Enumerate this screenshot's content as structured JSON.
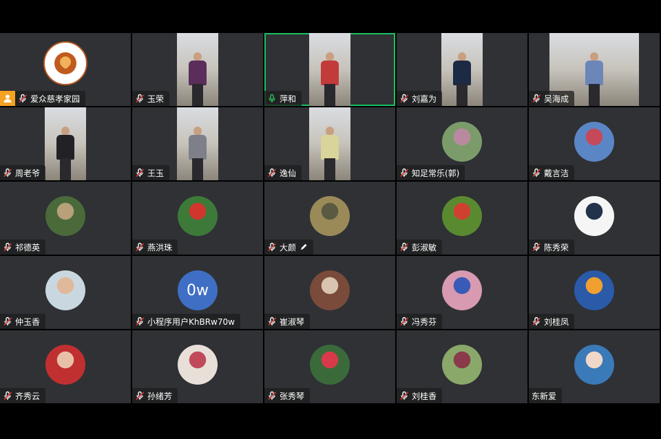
{
  "colors": {
    "tile_bg": "#2f3135",
    "active_border": "#19c15f",
    "muted_icon": "#d03a36",
    "unmuted_icon": "#2fc463",
    "host_badge": "#f5a122",
    "text_avatar": "#3f6fc4"
  },
  "participants": [
    {
      "name": "爱众慈孝家园",
      "kind": "logo",
      "host": true,
      "mic": "muted"
    },
    {
      "name": "玉荣",
      "kind": "video",
      "mic": "muted",
      "shirt": "#5a2d5a"
    },
    {
      "name": "萍和",
      "kind": "video",
      "mic": "on",
      "active": true,
      "shirt": "#c23a3a"
    },
    {
      "name": "刘嘉为",
      "kind": "video",
      "mic": "muted",
      "shirt": "#1c2a44"
    },
    {
      "name": "吴海成",
      "kind": "video-wide",
      "mic": "muted",
      "shirt": "#6b86b8"
    },
    {
      "name": "周老爷",
      "kind": "video",
      "mic": "muted",
      "shirt": "#222226"
    },
    {
      "name": "王玉",
      "kind": "video",
      "mic": "muted",
      "shirt": "#7d8088"
    },
    {
      "name": "逸仙",
      "kind": "video",
      "mic": "muted",
      "shirt": "#d8d49a"
    },
    {
      "name": "知足常乐(郭)",
      "kind": "photo",
      "mic": "muted",
      "tone": [
        "#7b9c6a",
        "#b98a9f"
      ]
    },
    {
      "name": "戴言洁",
      "kind": "photo",
      "mic": "muted",
      "tone": [
        "#5b86c6",
        "#c44a5a"
      ]
    },
    {
      "name": "祁德英",
      "kind": "photo",
      "mic": "muted",
      "tone": [
        "#4a6a3a",
        "#b7a07a"
      ]
    },
    {
      "name": "燕洪珠",
      "kind": "photo",
      "mic": "muted",
      "tone": [
        "#3d7a3a",
        "#d0352e"
      ]
    },
    {
      "name": "大颜",
      "kind": "photo",
      "mic": "muted",
      "pencil": true,
      "tone": [
        "#9a8a58",
        "#5a5a42"
      ]
    },
    {
      "name": "彭淑敏",
      "kind": "photo",
      "mic": "muted",
      "tone": [
        "#5a8a30",
        "#d04030"
      ]
    },
    {
      "name": "陈秀荣",
      "kind": "photo",
      "mic": "muted",
      "tone": [
        "#f5f5f5",
        "#22324a"
      ]
    },
    {
      "name": "仲玉香",
      "kind": "photo",
      "mic": "muted",
      "tone": [
        "#c9d8e0",
        "#e0b89a"
      ]
    },
    {
      "name": "小程序用户KhBRw70w",
      "kind": "text",
      "initials": "0w",
      "mic": "muted"
    },
    {
      "name": "崔淑琴",
      "kind": "photo",
      "mic": "muted",
      "tone": [
        "#7a4a3a",
        "#d8c4b0"
      ]
    },
    {
      "name": "冯秀芬",
      "kind": "photo",
      "mic": "muted",
      "tone": [
        "#d89ab0",
        "#3a5ab8"
      ]
    },
    {
      "name": "刘桂凤",
      "kind": "photo",
      "mic": "muted",
      "tone": [
        "#2a5aa8",
        "#f0a030"
      ]
    },
    {
      "name": "齐秀云",
      "kind": "photo",
      "mic": "muted",
      "tone": [
        "#c03030",
        "#e8c0a8"
      ]
    },
    {
      "name": "孙绪芳",
      "kind": "photo",
      "mic": "muted",
      "tone": [
        "#e8e0d8",
        "#c04a5a"
      ]
    },
    {
      "name": "张秀琴",
      "kind": "photo",
      "mic": "muted",
      "tone": [
        "#3a6a3a",
        "#d83a4a"
      ]
    },
    {
      "name": "刘桂香",
      "kind": "photo",
      "mic": "muted",
      "tone": [
        "#8aa86a",
        "#8a3a4a"
      ]
    },
    {
      "name": "东新爱",
      "kind": "photo",
      "mic": "none",
      "tone": [
        "#3a7ab8",
        "#f0d8c8"
      ]
    }
  ]
}
